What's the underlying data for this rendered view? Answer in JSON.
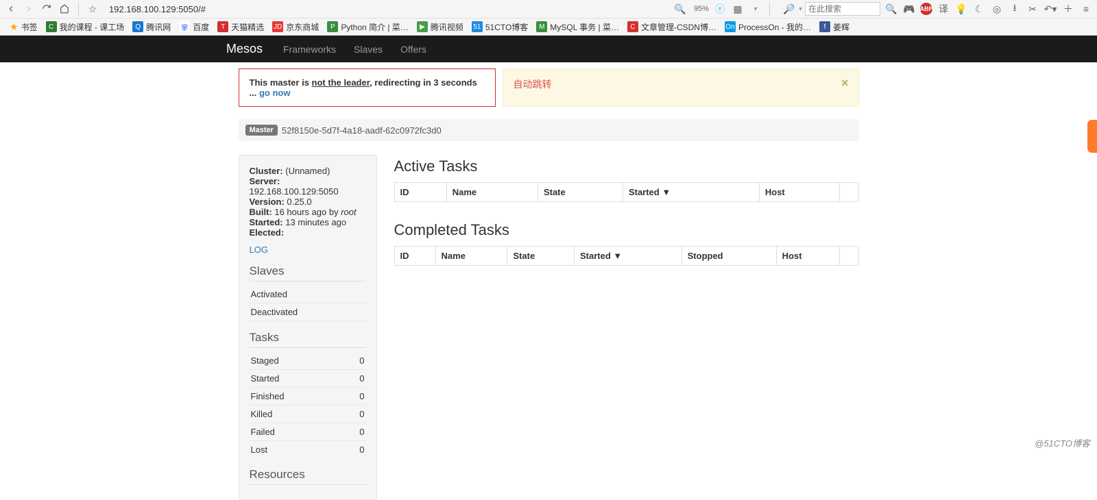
{
  "browser": {
    "url": "192.168.100.129:5050/#",
    "zoom": "95%",
    "search_placeholder": "在此搜索"
  },
  "bookmarks": [
    {
      "label": "书签",
      "icon_bg": "#ffa500",
      "icon_text": "★"
    },
    {
      "label": "我的课程 - 课工场",
      "icon_bg": "#2e7d32",
      "icon_text": "C"
    },
    {
      "label": "腾讯网",
      "icon_bg": "#1976d2",
      "icon_text": "Q"
    },
    {
      "label": "百度",
      "icon_bg": "#2962ff",
      "icon_text": "掌"
    },
    {
      "label": "天猫精选",
      "icon_bg": "#d32f2f",
      "icon_text": "T"
    },
    {
      "label": "京东商城",
      "icon_bg": "#e53935",
      "icon_text": "JD"
    },
    {
      "label": "Python 简介 | 菜…",
      "icon_bg": "#388e3c",
      "icon_text": "P"
    },
    {
      "label": "腾讯视频",
      "icon_bg": "#43a047",
      "icon_text": "▶"
    },
    {
      "label": "51CTO博客",
      "icon_bg": "#1e88e5",
      "icon_text": "51"
    },
    {
      "label": "MySQL 事务 | 菜…",
      "icon_bg": "#388e3c",
      "icon_text": "M"
    },
    {
      "label": "文章管理-CSDN博…",
      "icon_bg": "#d32f2f",
      "icon_text": "C"
    },
    {
      "label": "ProcessOn - 我的…",
      "icon_bg": "#039be5",
      "icon_text": "On"
    },
    {
      "label": "姜辉",
      "icon_bg": "#3b5998",
      "icon_text": "f"
    }
  ],
  "nav": {
    "brand": "Mesos",
    "items": [
      "Frameworks",
      "Slaves",
      "Offers"
    ]
  },
  "alerts": {
    "leader_prefix": "This master is ",
    "leader_mid": "not the leader",
    "leader_suffix": ", redirecting in 3 seconds ... ",
    "leader_link": "go now",
    "yellow_text": "自动跳转"
  },
  "master": {
    "badge": "Master",
    "id": "52f8150e-5d7f-4a18-aadf-62c0972fc3d0"
  },
  "sidebar": {
    "cluster_label": "Cluster:",
    "cluster_value": "(Unnamed)",
    "server_label": "Server:",
    "server_value": "192.168.100.129:5050",
    "version_label": "Version:",
    "version_value": "0.25.0",
    "built_label": "Built:",
    "built_value": "16 hours ago by ",
    "built_user": "root",
    "started_label": "Started:",
    "started_value": "13 minutes ago",
    "elected_label": "Elected:",
    "elected_value": "",
    "log_link": "LOG",
    "slaves_heading": "Slaves",
    "slaves": [
      {
        "label": "Activated"
      },
      {
        "label": "Deactivated"
      }
    ],
    "tasks_heading": "Tasks",
    "tasks": [
      {
        "label": "Staged",
        "value": "0"
      },
      {
        "label": "Started",
        "value": "0"
      },
      {
        "label": "Finished",
        "value": "0"
      },
      {
        "label": "Killed",
        "value": "0"
      },
      {
        "label": "Failed",
        "value": "0"
      },
      {
        "label": "Lost",
        "value": "0"
      }
    ],
    "resources_heading": "Resources"
  },
  "content": {
    "active_heading": "Active Tasks",
    "active_cols": [
      "ID",
      "Name",
      "State",
      "Started ▼",
      "Host"
    ],
    "completed_heading": "Completed Tasks",
    "completed_cols": [
      "ID",
      "Name",
      "State",
      "Started ▼",
      "Stopped",
      "Host"
    ]
  },
  "watermark": "@51CTO博客"
}
